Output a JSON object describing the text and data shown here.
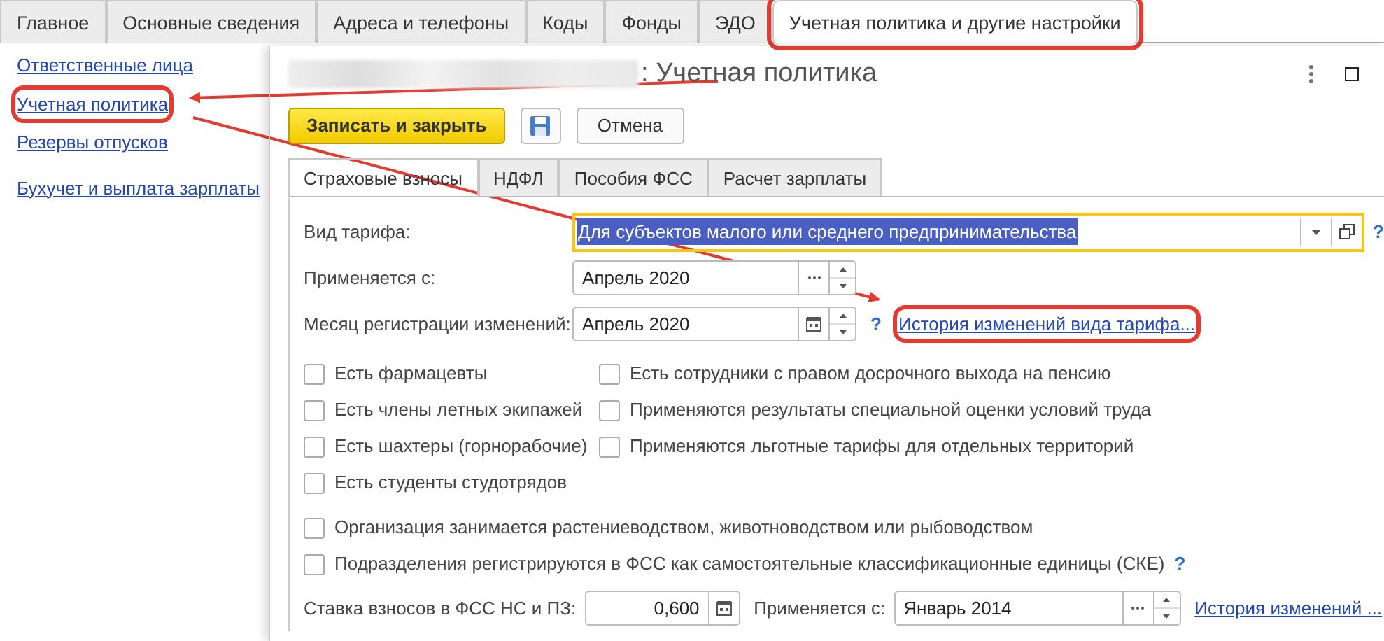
{
  "top_tabs": [
    {
      "label": "Главное",
      "selected": false,
      "highlighted": false
    },
    {
      "label": "Основные сведения",
      "selected": false,
      "highlighted": false
    },
    {
      "label": "Адреса и телефоны",
      "selected": false,
      "highlighted": false
    },
    {
      "label": "Коды",
      "selected": false,
      "highlighted": false
    },
    {
      "label": "Фонды",
      "selected": false,
      "highlighted": false
    },
    {
      "label": "ЭДО",
      "selected": false,
      "highlighted": false
    },
    {
      "label": "Учетная политика и другие настройки",
      "selected": true,
      "highlighted": true
    }
  ],
  "sidebar": {
    "items": [
      {
        "label": "Ответственные лица",
        "highlighted": false
      },
      {
        "label": "Учетная политика",
        "highlighted": true
      },
      {
        "label": "Резервы отпусков",
        "highlighted": false
      },
      {
        "label": "Бухучет и выплата зарплаты",
        "highlighted": false
      }
    ]
  },
  "form": {
    "title": ": Учетная политика",
    "title_redacted": true,
    "buttons": [
      {
        "kind": "primary",
        "label": "Записать и закрыть"
      },
      {
        "kind": "save"
      },
      {
        "kind": "default",
        "label": "Отмена"
      }
    ],
    "tabs": [
      {
        "label": "Страховые взносы",
        "selected": true
      },
      {
        "label": "НДФЛ",
        "selected": false
      },
      {
        "label": "Пособия ФСС",
        "selected": false
      },
      {
        "label": "Расчет зарплаты",
        "selected": false
      }
    ],
    "tariff": {
      "label": "Вид тарифа:",
      "value": "Для субъектов малого или среднего предпринимательства",
      "focused": true,
      "help": "?"
    },
    "applies_from": {
      "label": "Применяется с:",
      "value": "Апрель 2020"
    },
    "registration_month": {
      "label": "Месяц регистрации изменений:",
      "value": "Апрель 2020",
      "help": "?",
      "history_link": {
        "label": "История изменений вида тарифа...",
        "highlighted": true
      }
    },
    "checkboxes_left": [
      {
        "label": "Есть фармацевты",
        "checked": false
      },
      {
        "label": "Есть члены летных экипажей",
        "checked": false
      },
      {
        "label": "Есть шахтеры (горнорабочие)",
        "checked": false
      },
      {
        "label": "Есть студенты студотрядов",
        "checked": false
      }
    ],
    "checkboxes_right": [
      {
        "label": "Есть сотрудники с правом досрочного выхода на пенсию",
        "checked": false
      },
      {
        "label": "Применяются результаты специальной оценки условий труда",
        "checked": false
      },
      {
        "label": "Применяются льготные тарифы для отдельных территорий",
        "checked": false
      }
    ],
    "checkboxes_wide": [
      {
        "label": "Организация занимается растениеводством, животноводством или рыбоводством",
        "checked": false
      },
      {
        "label": "Подразделения регистрируются в ФСС как самостоятельные классификационные единицы (СКЕ)",
        "checked": false,
        "help": "?"
      }
    ],
    "fss_rate": {
      "label": "Ставка взносов в ФСС НС и ПЗ:",
      "value": "0,600",
      "applies_label": "Применяется с:",
      "applies_value": "Январь 2014",
      "history_link": "История изменений ..."
    }
  }
}
